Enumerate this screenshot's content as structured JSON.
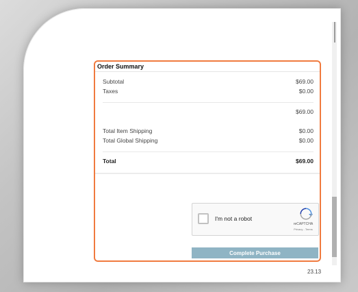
{
  "order_summary": {
    "title": "Order Summary",
    "subtotal_label": "Subtotal",
    "subtotal_value": "$69.00",
    "taxes_label": "Taxes",
    "taxes_value": "$0.00",
    "intermediate_total": "$69.00",
    "item_shipping_label": "Total Item Shipping",
    "item_shipping_value": "$0.00",
    "global_shipping_label": "Total Global Shipping",
    "global_shipping_value": "$0.00",
    "total_label": "Total",
    "total_value": "$69.00"
  },
  "recaptcha": {
    "label": "I'm not a robot",
    "brand": "reCAPTCHA",
    "terms": "Privacy - Terms"
  },
  "purchase_button": {
    "label": "Complete Purchase"
  },
  "footer": {
    "version": "23.13"
  },
  "colors": {
    "highlight_border": "#f07a3e",
    "button_bg": "#8fb4c4",
    "recaptcha_blue": "#4a90e2"
  }
}
